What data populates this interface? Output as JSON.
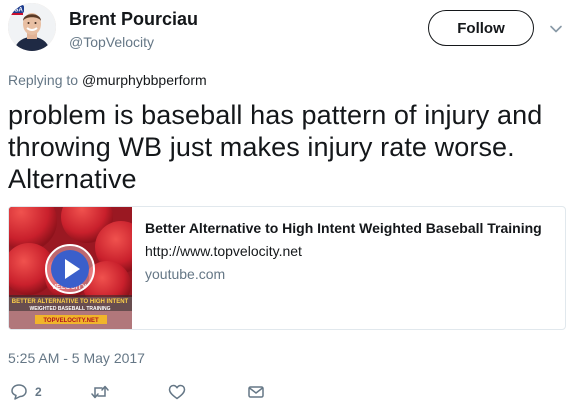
{
  "user": {
    "name": "Brent Pourciau",
    "handle": "@TopVelocity",
    "avatar_badge": "USA"
  },
  "follow_label": "Follow",
  "replying": {
    "prefix": "Replying to",
    "mention": "@murphybbperform"
  },
  "tweet_text": "problem is baseball has pattern of injury and throwing WB just makes injury rate worse. Alternative",
  "card": {
    "title": "Better Alternative to High Intent Weighted Baseball Training",
    "description": "http://www.topvelocity.net",
    "domain": "youtube.com",
    "thumb_caption_line1": "BETTER ALTERNATIVE TO HIGH INTENT",
    "thumb_caption_line2": "WEIGHTED BASEBALL TRAINING",
    "thumb_brand": "TOPVELOCITY.NET",
    "thumb_ball_text": "VELOCITY"
  },
  "timestamp": "5:25 AM - 5 May 2017",
  "actions": {
    "reply_count": "2"
  },
  "colors": {
    "text": "#14171a",
    "secondary": "#657786",
    "border": "#e1e8ed",
    "thumb_red": "#c9202c"
  }
}
